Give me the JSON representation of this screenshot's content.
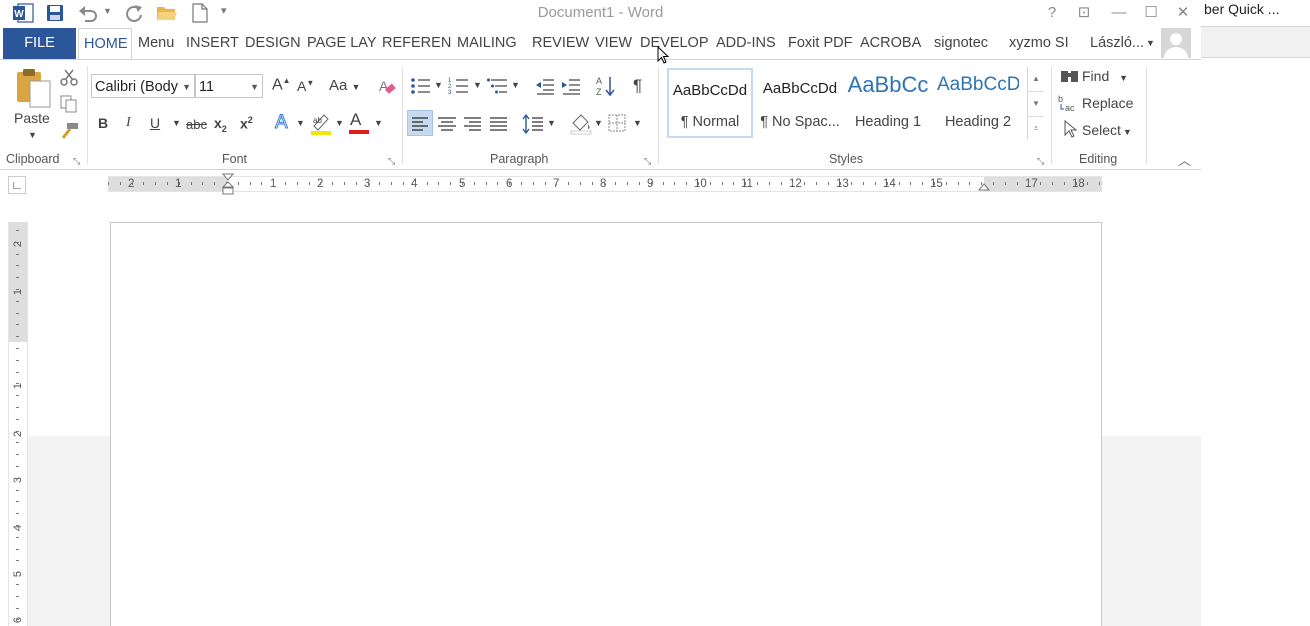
{
  "window": {
    "title": "Document1 - Word",
    "help": "?",
    "controls": {
      "restore_ribbon": "⊡",
      "minimize": "—",
      "maximize": "☐",
      "close": "✕"
    }
  },
  "background_window": {
    "title": "ber Quick ..."
  },
  "tabs": [
    {
      "label": "FILE"
    },
    {
      "label": "HOME"
    },
    {
      "label": "Menu"
    },
    {
      "label": "INSERT"
    },
    {
      "label": "DESIGN"
    },
    {
      "label": "PAGE LAY"
    },
    {
      "label": "REFEREN"
    },
    {
      "label": "MAILING"
    },
    {
      "label": "REVIEW"
    },
    {
      "label": "VIEW"
    },
    {
      "label": "DEVELOP"
    },
    {
      "label": "ADD-INS"
    },
    {
      "label": "Foxit PDF"
    },
    {
      "label": "ACROBA"
    },
    {
      "label": "signotec"
    },
    {
      "label": "xyzmo SI"
    }
  ],
  "user": {
    "name": "László..."
  },
  "clipboard": {
    "paste_label": "Paste",
    "group_label": "Clipboard"
  },
  "font": {
    "name": "Calibri (Body",
    "size": "11",
    "group_label": "Font",
    "bold": "B",
    "italic": "I",
    "underline": "U",
    "strike": "abc",
    "grow": "A",
    "shrink": "A",
    "case": "Aa",
    "sub": "x",
    "sub_mark": "2",
    "sup": "x",
    "sup_mark": "2",
    "effects": "A",
    "highlight_color": "#f5e60a",
    "font_color": "#e11b1b",
    "font_color_letter": "A"
  },
  "paragraph": {
    "group_label": "Paragraph",
    "pilcrow": "¶"
  },
  "styles": {
    "group_label": "Styles",
    "items": [
      {
        "preview": "AaBbCcDd",
        "name": "¶ Normal"
      },
      {
        "preview": "AaBbCcDd",
        "name": "¶ No Spac..."
      },
      {
        "preview": "AaBbCc",
        "name": "Heading 1"
      },
      {
        "preview": "AaBbCcD",
        "name": "Heading 2"
      }
    ]
  },
  "editing": {
    "group_label": "Editing",
    "find": "Find",
    "replace": "Replace",
    "select": "Select"
  },
  "ruler": {
    "h_numbers": [
      "2",
      "1",
      "1",
      "2",
      "3",
      "4",
      "5",
      "6",
      "7",
      "8",
      "9",
      "10",
      "11",
      "12",
      "13",
      "14",
      "15",
      "17",
      "18"
    ],
    "v_numbers": [
      "2",
      "1",
      "1",
      "2",
      "3",
      "4",
      "5",
      "6"
    ]
  },
  "colors": {
    "accent": "#2b579a",
    "heading_blue": "#2e74b5"
  }
}
